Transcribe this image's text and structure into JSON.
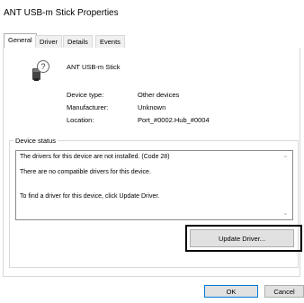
{
  "window": {
    "title": "ANT USB-m Stick Properties"
  },
  "tabs": [
    {
      "label": "General"
    },
    {
      "label": "Driver"
    },
    {
      "label": "Details"
    },
    {
      "label": "Events"
    }
  ],
  "device": {
    "icon": "unknown-device-icon",
    "name": "ANT USB-m Stick",
    "rows": [
      {
        "label": "Device type:",
        "value": "Other devices"
      },
      {
        "label": "Manufacturer:",
        "value": "Unknown"
      },
      {
        "label": "Location:",
        "value": "Port_#0002.Hub_#0004"
      }
    ]
  },
  "status": {
    "legend": "Device status",
    "lines": [
      "The drivers for this device are not installed. (Code 28)",
      "There are no compatible drivers for this device.",
      "To find a driver for this device, click Update Driver."
    ]
  },
  "buttons": {
    "update_driver": "Update Driver...",
    "ok": "OK",
    "cancel": "Cancel"
  }
}
